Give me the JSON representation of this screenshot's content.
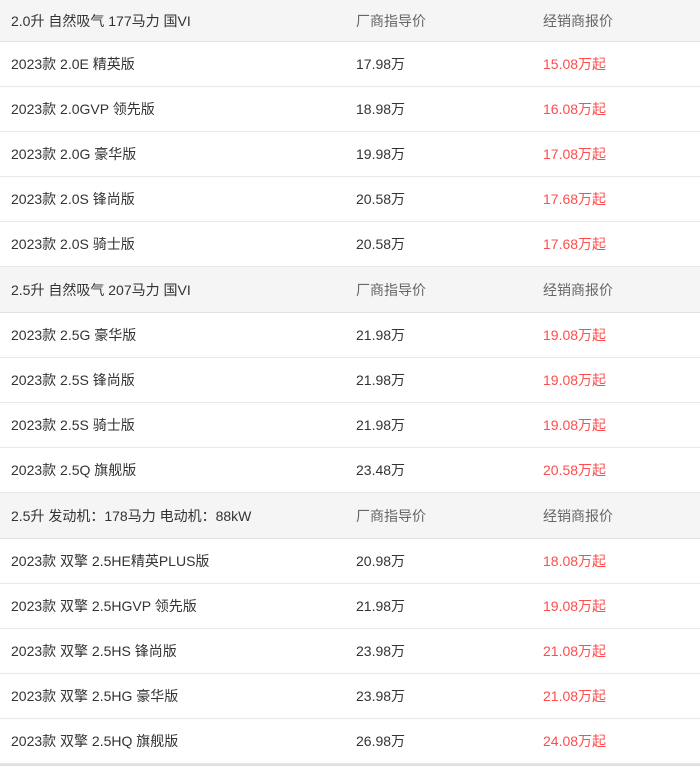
{
  "accent_color": "#ff4c4c",
  "groups": [
    {
      "header": {
        "engine": "2.0升 自然吸气 177马力 国VI",
        "msrp_label": "厂商指导价",
        "dealer_label": "经销商报价"
      },
      "rows": [
        {
          "name": "2023款 2.0E 精英版",
          "msrp": "17.98万",
          "dealer": "15.08万起"
        },
        {
          "name": "2023款 2.0GVP 领先版",
          "msrp": "18.98万",
          "dealer": "16.08万起"
        },
        {
          "name": "2023款 2.0G 豪华版",
          "msrp": "19.98万",
          "dealer": "17.08万起"
        },
        {
          "name": "2023款 2.0S 锋尚版",
          "msrp": "20.58万",
          "dealer": "17.68万起"
        },
        {
          "name": "2023款 2.0S 骑士版",
          "msrp": "20.58万",
          "dealer": "17.68万起"
        }
      ]
    },
    {
      "header": {
        "engine": "2.5升 自然吸气 207马力 国VI",
        "msrp_label": "厂商指导价",
        "dealer_label": "经销商报价"
      },
      "rows": [
        {
          "name": "2023款 2.5G 豪华版",
          "msrp": "21.98万",
          "dealer": "19.08万起"
        },
        {
          "name": "2023款 2.5S 锋尚版",
          "msrp": "21.98万",
          "dealer": "19.08万起"
        },
        {
          "name": "2023款 2.5S 骑士版",
          "msrp": "21.98万",
          "dealer": "19.08万起"
        },
        {
          "name": "2023款 2.5Q 旗舰版",
          "msrp": "23.48万",
          "dealer": "20.58万起"
        }
      ]
    },
    {
      "header": {
        "engine": "2.5升 发动机：178马力 电动机：88kW",
        "msrp_label": "厂商指导价",
        "dealer_label": "经销商报价"
      },
      "rows": [
        {
          "name": "2023款 双擎 2.5HE精英PLUS版",
          "msrp": "20.98万",
          "dealer": "18.08万起"
        },
        {
          "name": "2023款 双擎 2.5HGVP 领先版",
          "msrp": "21.98万",
          "dealer": "19.08万起"
        },
        {
          "name": "2023款 双擎 2.5HS 锋尚版",
          "msrp": "23.98万",
          "dealer": "21.08万起"
        },
        {
          "name": "2023款 双擎 2.5HG 豪华版",
          "msrp": "23.98万",
          "dealer": "21.08万起"
        },
        {
          "name": "2023款 双擎 2.5HQ 旗舰版",
          "msrp": "26.98万",
          "dealer": "24.08万起"
        }
      ]
    }
  ]
}
